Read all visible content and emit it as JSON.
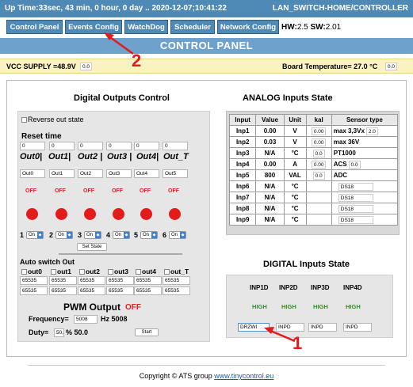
{
  "header": {
    "uptime": "Up Time:33sec, 43 min, 0 hour, 0 day .. 2020-12-07;10:41:22",
    "device": "LAN_SWITCH-HOME/CONTROLLER"
  },
  "nav": [
    "Control Panel",
    "Events Config",
    "WatchDog",
    "Scheduler",
    "Network Config"
  ],
  "hw": {
    "hw_label": "HW:",
    "hw_value": "2.5",
    "sw_label": "SW:",
    "sw_value": "2.01"
  },
  "control_panel_title": "CONTROL PANEL",
  "vcc": {
    "label": "VCC SUPPLY =48.9V",
    "cal": "0.0"
  },
  "board_temp": {
    "label": "Board Temperature= 27.0 °C",
    "cal": "0.0"
  },
  "digital_outputs": {
    "title": "Digital Outputs Control",
    "reverse": "Reverse out state",
    "reset_label": "Reset time",
    "reset_values": [
      "0",
      "0",
      "0",
      "0",
      "0",
      "0"
    ],
    "headers": [
      "Out0|",
      "Out1|",
      "Out2 |",
      "Out3 |",
      "Out4|",
      "Out_T"
    ],
    "names": [
      "Out0",
      "Out1",
      "Out2",
      "Out3",
      "Out4",
      "Out5"
    ],
    "states": [
      "OFF",
      "OFF",
      "OFF",
      "OFF",
      "OFF",
      "OFF"
    ],
    "selector_nums": [
      "1",
      "2",
      "3",
      "4",
      "5",
      "6"
    ],
    "selector_values": [
      "On",
      "On",
      "On",
      "On",
      "On",
      "On"
    ],
    "set_state": "Set State",
    "auto_switch_title": "Auto switch Out",
    "auto_switch_labels": [
      "out0",
      "out1",
      "out2",
      "out3",
      "out4",
      "out_T"
    ],
    "auto_row1": [
      "65535",
      "65535",
      "65535",
      "65535",
      "65535",
      "65535"
    ],
    "auto_row2": [
      "65535",
      "65535",
      "65535",
      "65535",
      "65535",
      "65535"
    ],
    "pwm_title": "PWM Output",
    "pwm_state": "OFF",
    "freq_label": "Frequency=",
    "freq_value": "5008",
    "freq_unit": "Hz 5008",
    "duty_label": "Duty=",
    "duty_value": "50.",
    "duty_unit": "% 50.0",
    "start": "Start"
  },
  "analog": {
    "title": "ANALOG Inputs State",
    "columns": [
      "Input",
      "Value",
      "Unit",
      "kal",
      "Sensor type"
    ],
    "rows": [
      {
        "input": "Inp1",
        "value": "0.00",
        "unit": "V",
        "kal": "0.00",
        "sensor": "max 3,3Vx",
        "sensor_box": "2.0"
      },
      {
        "input": "Inp2",
        "value": "0.03",
        "unit": "V",
        "kal": "0.00",
        "sensor": "max 36V",
        "sensor_box": ""
      },
      {
        "input": "Inp3",
        "value": "N/A",
        "unit": "°C",
        "kal": "0.0",
        "sensor": "PT1000",
        "sensor_box": ""
      },
      {
        "input": "Inp4",
        "value": "0.00",
        "unit": "A",
        "kal": "0.00",
        "sensor": "ACS",
        "sensor_box": "0.0"
      },
      {
        "input": "Inp5",
        "value": "800",
        "unit": "VAL",
        "kal": "0.0",
        "sensor": "ADC",
        "sensor_box": ""
      },
      {
        "input": "Inp6",
        "value": "N/A",
        "unit": "°C",
        "kal": "",
        "sensor": "",
        "sensor_box": "DS18"
      },
      {
        "input": "Inp7",
        "value": "N/A",
        "unit": "°C",
        "kal": "",
        "sensor": "",
        "sensor_box": "DS18"
      },
      {
        "input": "Inp8",
        "value": "N/A",
        "unit": "°C",
        "kal": "",
        "sensor": "",
        "sensor_box": "DS18"
      },
      {
        "input": "Inp9",
        "value": "N/A",
        "unit": "°C",
        "kal": "",
        "sensor": "",
        "sensor_box": "DS18"
      }
    ]
  },
  "digital_inputs": {
    "title": "DIGITAL Inputs State",
    "labels": [
      "INP1D",
      "INP2D",
      "INP3D",
      "INP4D"
    ],
    "states": [
      "HIGH",
      "HIGH",
      "HIGH",
      "HIGH"
    ],
    "names": [
      "DRZWI",
      "INPD",
      "INPD",
      "INPD"
    ]
  },
  "annotations": {
    "n1": "1",
    "n2": "2"
  },
  "footer": {
    "text": "Copyright © ATS group ",
    "link": "www.tinycontrol.eu"
  }
}
